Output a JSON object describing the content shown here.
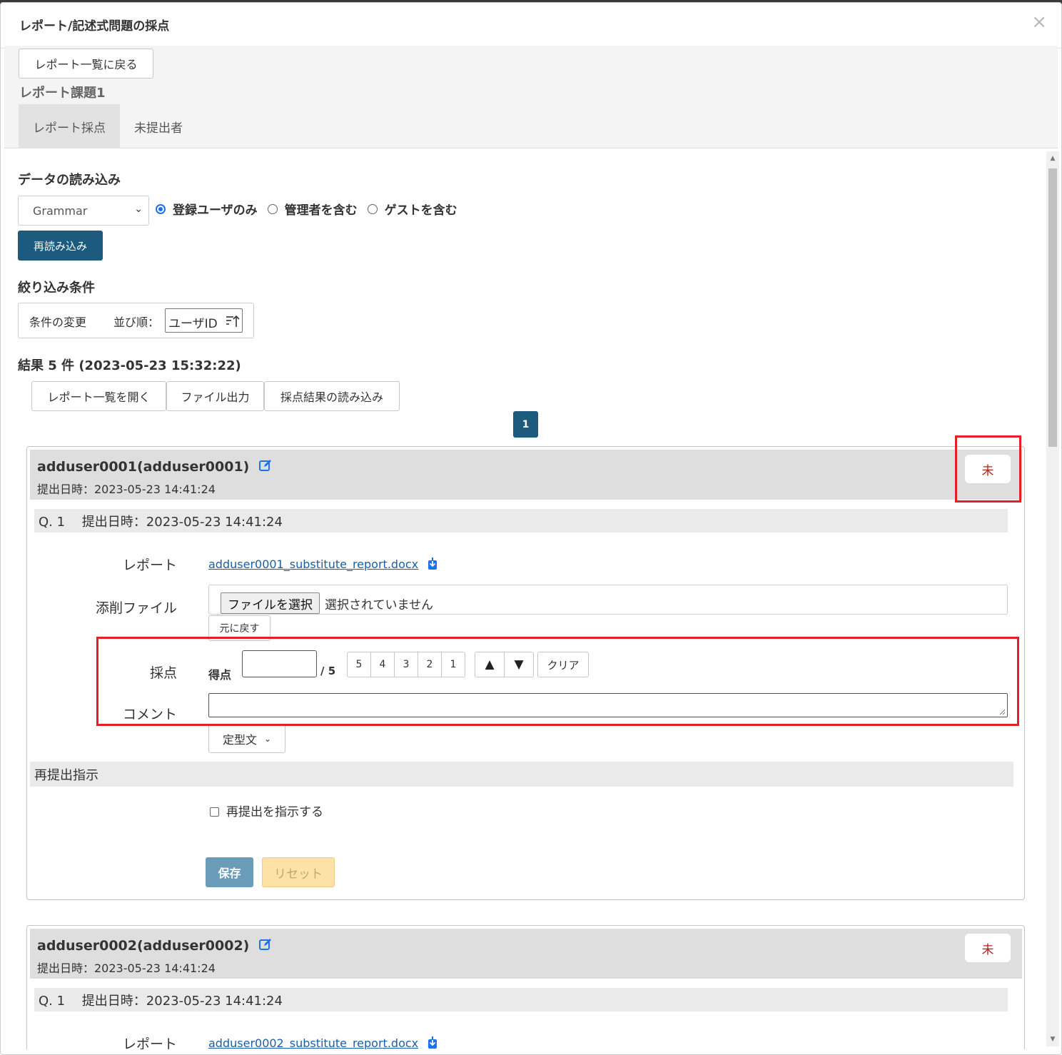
{
  "modal": {
    "title": "レポート/記述式問題の採点",
    "close": "×"
  },
  "header": {
    "back_label": "レポート一覧に戻る",
    "subject": "レポート課題1"
  },
  "tabs": [
    {
      "label": "レポート採点",
      "active": true
    },
    {
      "label": "未提出者",
      "active": false
    }
  ],
  "data_load": {
    "heading": "データの読み込み",
    "class_select": "Grammar",
    "radios": [
      {
        "label": "登録ユーザのみ",
        "checked": true
      },
      {
        "label": "管理者を含む",
        "checked": false
      },
      {
        "label": "ゲストを含む",
        "checked": false
      }
    ],
    "reload_label": "再読み込み"
  },
  "filter": {
    "heading": "絞り込み条件",
    "change_label": "条件の変更",
    "sort_label": "並び順：",
    "sort_value": "ユーザID"
  },
  "results": {
    "summary": "結果 5 件 (2023-05-23 15:32:22)",
    "open_list_label": "レポート一覧を開く",
    "export_label": "ファイル出力",
    "import_label": "採点結果の読み込み",
    "page": "1"
  },
  "submissions": [
    {
      "user": "adduser0001(adduser0001)",
      "submitted": "提出日時：2023-05-23 14:41:24",
      "status": "未",
      "question": "Q. 1　 提出日時：2023-05-23 14:41:24",
      "report_label": "レポート",
      "report_file": "adduser0001_substitute_report.docx",
      "attach_label": "添削ファイル",
      "file_button": "ファイルを選択",
      "file_status": "選択されていません",
      "revert_label": "元に戻す",
      "grade_label": "採点",
      "score_label": "得点",
      "score_value": "",
      "score_max": "/ 5",
      "score_options": [
        "5",
        "4",
        "3",
        "2",
        "1"
      ],
      "up_label": "▲",
      "down_label": "▼",
      "clear_label": "クリア",
      "comment_label": "コメント",
      "comment_value": "",
      "template_label": "定型文",
      "resubmit_heading": "再提出指示",
      "resubmit_checkbox": "再提出を指示する",
      "save_label": "保存",
      "reset_label": "リセット"
    },
    {
      "user": "adduser0002(adduser0002)",
      "submitted": "提出日時：2023-05-23 14:41:24",
      "status": "未",
      "question": "Q. 1　 提出日時：2023-05-23 14:41:24",
      "report_label": "レポート",
      "report_file": "adduser0002_substitute_report.docx"
    }
  ],
  "colors": {
    "primary": "#1c5a7e",
    "highlight": "#e1202a",
    "status_text": "#b22222",
    "link": "#1a5fa8"
  }
}
